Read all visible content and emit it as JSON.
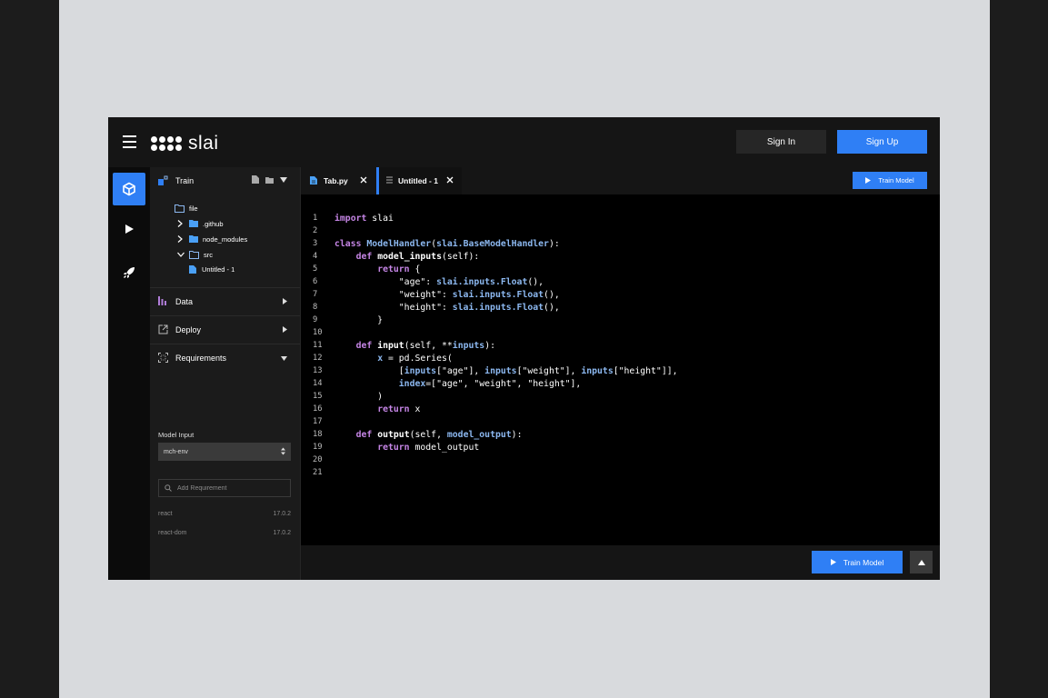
{
  "header": {
    "logo_text": "slai",
    "sign_in_label": "Sign In",
    "sign_up_label": "Sign Up"
  },
  "rail": {
    "items": [
      {
        "icon": "cube-icon",
        "active": true
      },
      {
        "icon": "play-icon",
        "active": false
      },
      {
        "icon": "rocket-icon",
        "active": false
      }
    ]
  },
  "panel": {
    "title": "Train",
    "tree": [
      {
        "label": "file",
        "type": "folder-outline"
      },
      {
        "label": ".github",
        "type": "folder"
      },
      {
        "label": "node_modules",
        "type": "folder"
      },
      {
        "label": "src",
        "type": "folder-outline"
      },
      {
        "label": "Untitled - 1",
        "type": "file"
      }
    ],
    "sections": {
      "data": "Data",
      "deploy": "Deploy",
      "requirements": "Requirements"
    },
    "model_input_label": "Model Input",
    "env_select": "mch-env",
    "add_requirement_placeholder": "Add Requirement",
    "requirements": [
      {
        "name": "react",
        "version": "17.0.2"
      },
      {
        "name": "react-dom",
        "version": "17.0.2"
      }
    ]
  },
  "editor": {
    "tabs": [
      {
        "label": "Tab.py"
      },
      {
        "label": "Untitled - 1"
      }
    ],
    "train_model_label": "Train Model",
    "line_count": 21,
    "code_lines": [
      "import slai",
      "",
      "class ModelHandler(slai.BaseModelHandler):",
      "    def model_inputs(self):",
      "        return {",
      "            \"age\": slai.inputs.Float(),",
      "            \"weight\": slai.inputs.Float(),",
      "            \"height\": slai.inputs.Float(),",
      "        }",
      "",
      "    def input(self, **inputs):",
      "        x = pd.Series(",
      "            [inputs[\"age\"], inputs[\"weight\"], inputs[\"height\"]],",
      "            index=[\"age\", \"weight\", \"height\"],",
      "        )",
      "        return x",
      "",
      "    def output(self, model_output):",
      "        return model_output",
      "",
      ""
    ]
  },
  "colors": {
    "accent": "#2f7ff5",
    "keyword": "#c585e5",
    "class": "#8cb8f0",
    "background": "#000000"
  }
}
